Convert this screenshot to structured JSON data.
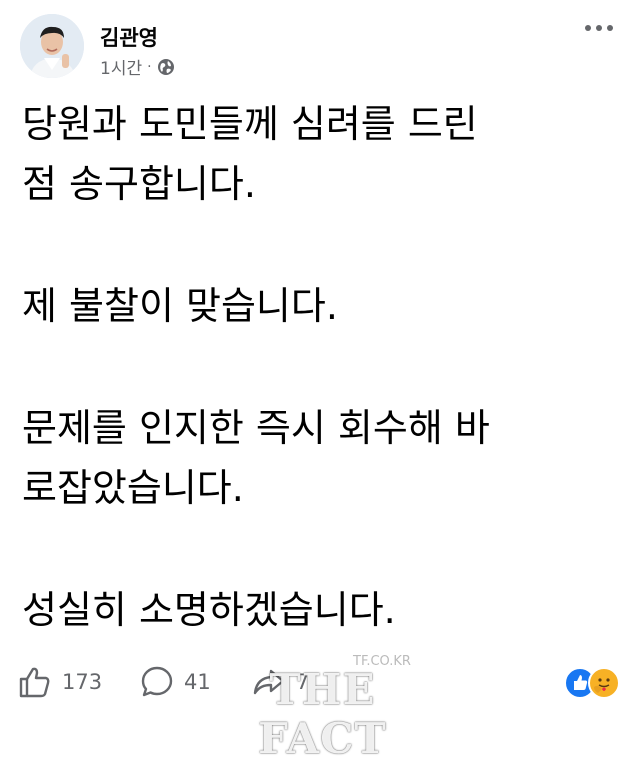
{
  "post": {
    "author": "김관영",
    "time": "1시간",
    "separator": "·",
    "privacy_icon": "globe-icon",
    "paragraphs": [
      [
        "당원과 도민들께 심려를 드린",
        "점 송구합니다."
      ],
      [
        "제 불찰이 맞습니다."
      ],
      [
        "문제를 인지한 즉시 회수해 바",
        "로잡았습니다."
      ],
      [
        "성실히 소명하겠습니다."
      ]
    ]
  },
  "footer": {
    "likes": "173",
    "comments": "41",
    "shares": "7"
  },
  "watermark": {
    "text": "THE FACT",
    "url": "TF.CO.KR"
  },
  "colors": {
    "like_blue": "#1877f2",
    "meta_gray": "#65676b",
    "text": "#050505"
  }
}
